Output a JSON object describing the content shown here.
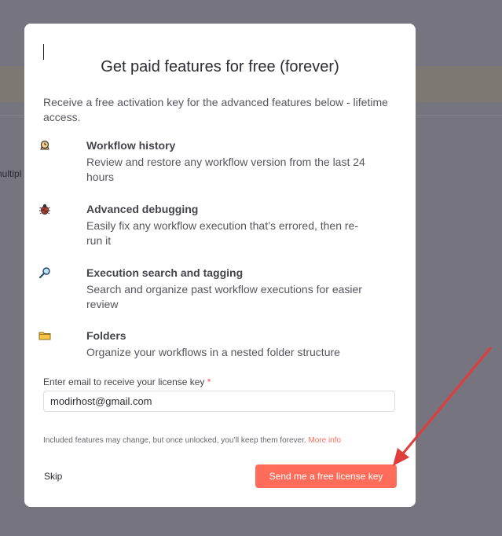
{
  "background": {
    "snippet": "nultipl"
  },
  "modal": {
    "title": "Get paid features for free (forever)",
    "intro": "Receive a free activation key for the advanced features below - lifetime access.",
    "features": [
      {
        "icon": "history-icon",
        "title": "Workflow history",
        "desc": "Review and restore any workflow version from the last 24 hours"
      },
      {
        "icon": "bug-icon",
        "title": "Advanced debugging",
        "desc": "Easily fix any workflow execution that’s errored, then re-run it"
      },
      {
        "icon": "magnifier-icon",
        "title": "Execution search and tagging",
        "desc": "Search and organize past workflow executions for easier review"
      },
      {
        "icon": "folder-icon",
        "title": "Folders",
        "desc": "Organize your workflows in a nested folder structure"
      }
    ],
    "email": {
      "label": "Enter email to receive your license key",
      "required_mark": "*",
      "value": "modirhost@gmail.com"
    },
    "note": {
      "text": "Included features may change, but once unlocked, you’ll keep them forever.",
      "link": "More info"
    },
    "skip_label": "Skip",
    "cta_label": "Send me a free license key"
  },
  "colors": {
    "accent": "#ff6d5a",
    "overlay": "#75747f",
    "annotation_arrow": "#e03c3c"
  }
}
